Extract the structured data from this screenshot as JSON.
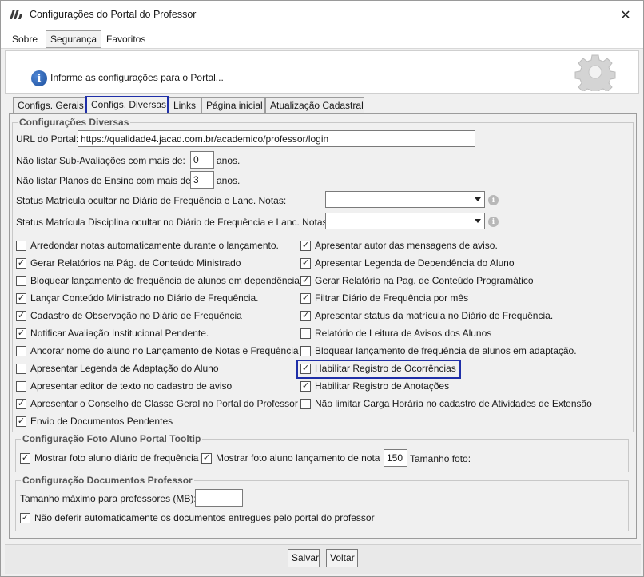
{
  "window": {
    "title": "Configurações do Portal do Professor"
  },
  "menu": [
    "Sobre",
    "Segurança",
    "Favoritos"
  ],
  "banner": {
    "text": "Informe as configurações para o Portal..."
  },
  "tabs": [
    "Configs. Gerais",
    "Configs. Diversas",
    "Links",
    "Página inicial",
    "Atualização Cadastral"
  ],
  "diversas": {
    "title": "Configurações Diversas",
    "url_label": "URL do Portal:",
    "url_value": "https://qualidade4.jacad.com.br/academico/professor/login",
    "sub_aval_label": "Não listar Sub-Avaliações com mais de:",
    "sub_aval_value": "0",
    "sub_aval_unit": "anos.",
    "planos_label": "Não listar Planos de Ensino com mais de:",
    "planos_value": "3",
    "planos_unit": "anos.",
    "status_mat_label": "Status Matrícula ocultar no Diário de Frequência e Lanc. Notas:",
    "status_mat_disc_label": "Status Matrícula Disciplina ocultar no Diário de Frequência e Lanc. Notas:",
    "left_checks": [
      {
        "label": "Arredondar notas automaticamente durante o lançamento.",
        "checked": false
      },
      {
        "label": "Gerar Relatórios na Pág. de Conteúdo Ministrado",
        "checked": true
      },
      {
        "label": "Bloquear lançamento de frequência de alunos em dependência.",
        "checked": false
      },
      {
        "label": "Lançar Conteúdo Ministrado no Diário de Frequência.",
        "checked": true
      },
      {
        "label": "Cadastro de Observação no Diário de Frequência",
        "checked": true
      },
      {
        "label": "Notificar Avaliação Institucional Pendente.",
        "checked": true
      },
      {
        "label": "Ancorar nome do aluno no Lançamento de Notas e Frequência",
        "checked": false
      },
      {
        "label": "Apresentar Legenda de Adaptação do Aluno",
        "checked": false
      },
      {
        "label": "Apresentar editor de texto no cadastro de aviso",
        "checked": false
      },
      {
        "label": "Apresentar o Conselho de Classe Geral no Portal do Professor",
        "checked": true
      },
      {
        "label": "Envio de Documentos Pendentes",
        "checked": true
      }
    ],
    "right_checks": [
      {
        "label": "Apresentar autor das mensagens de aviso.",
        "checked": true
      },
      {
        "label": "Apresentar Legenda de Dependência do Aluno",
        "checked": true
      },
      {
        "label": "Gerar Relatório na Pag. de Conteúdo Programático",
        "checked": true
      },
      {
        "label": "Filtrar Diário de Frequência por mês",
        "checked": true
      },
      {
        "label": "Apresentar status da matrícula no Diário de Frequência.",
        "checked": true
      },
      {
        "label": "Relatório de Leitura de Avisos dos Alunos",
        "checked": false
      },
      {
        "label": "Bloquear lançamento de frequência de alunos em adaptação.",
        "checked": false
      },
      {
        "label": "Habilitar Registro de Ocorrências",
        "checked": true
      },
      {
        "label": "Habilitar Registro de Anotações",
        "checked": true
      },
      {
        "label": "Não limitar Carga Horária no cadastro de Atividades de Extensão",
        "checked": false
      }
    ]
  },
  "foto": {
    "title": "Configuração Foto Aluno Portal Tooltip",
    "diario_label": "Mostrar foto aluno diário de frequência",
    "diario_checked": true,
    "nota_label": "Mostrar foto aluno lançamento de nota",
    "nota_checked": true,
    "tamanho_value": "150",
    "tamanho_label": "Tamanho foto:"
  },
  "docs": {
    "title": "Configuração Documentos Professor",
    "tamanho_label": "Tamanho máximo para professores (MB):",
    "tamanho_value": "",
    "deferir_label": "Não deferir automaticamente os documentos entregues pelo portal do professor",
    "deferir_checked": true
  },
  "buttons": {
    "save": "Salvar",
    "back": "Voltar"
  },
  "icons": {
    "check": "✓",
    "close": "✕",
    "info": "i"
  }
}
